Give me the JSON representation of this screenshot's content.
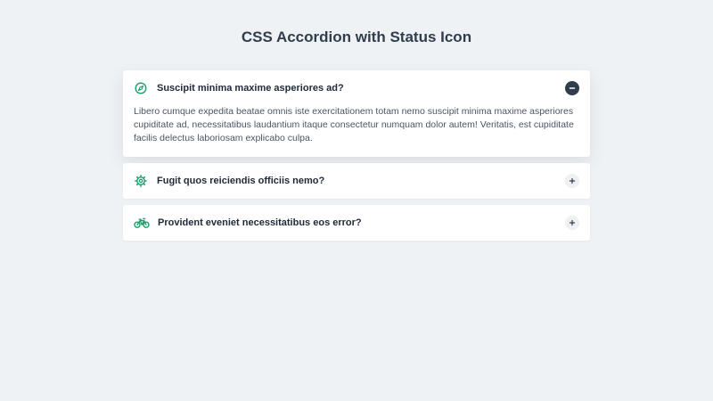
{
  "page": {
    "title": "CSS Accordion with Status Icon"
  },
  "accordion": {
    "items": [
      {
        "icon": "compass-icon",
        "title": "Suscipit minima maxime asperiores ad?",
        "expanded": true,
        "toggle_icon": "minus-icon",
        "body": "Libero cumque expedita beatae omnis iste exercitationem totam nemo suscipit minima maxime asperiores cupiditate ad, necessitatibus laudantium itaque consectetur numquam dolor autem! Veritatis, est cupiditate facilis delectus laboriosam explicabo culpa."
      },
      {
        "icon": "gear-icon",
        "title": "Fugit quos reiciendis officiis nemo?",
        "expanded": false,
        "toggle_icon": "plus-icon"
      },
      {
        "icon": "bicycle-icon",
        "title": "Provident eveniet necessitatibus eos error?",
        "expanded": false,
        "toggle_icon": "plus-icon"
      }
    ]
  },
  "colors": {
    "background": "#eff2f5",
    "accent": "#1e9e6a",
    "title": "#2f3d4c",
    "body_text": "#4a5565"
  }
}
